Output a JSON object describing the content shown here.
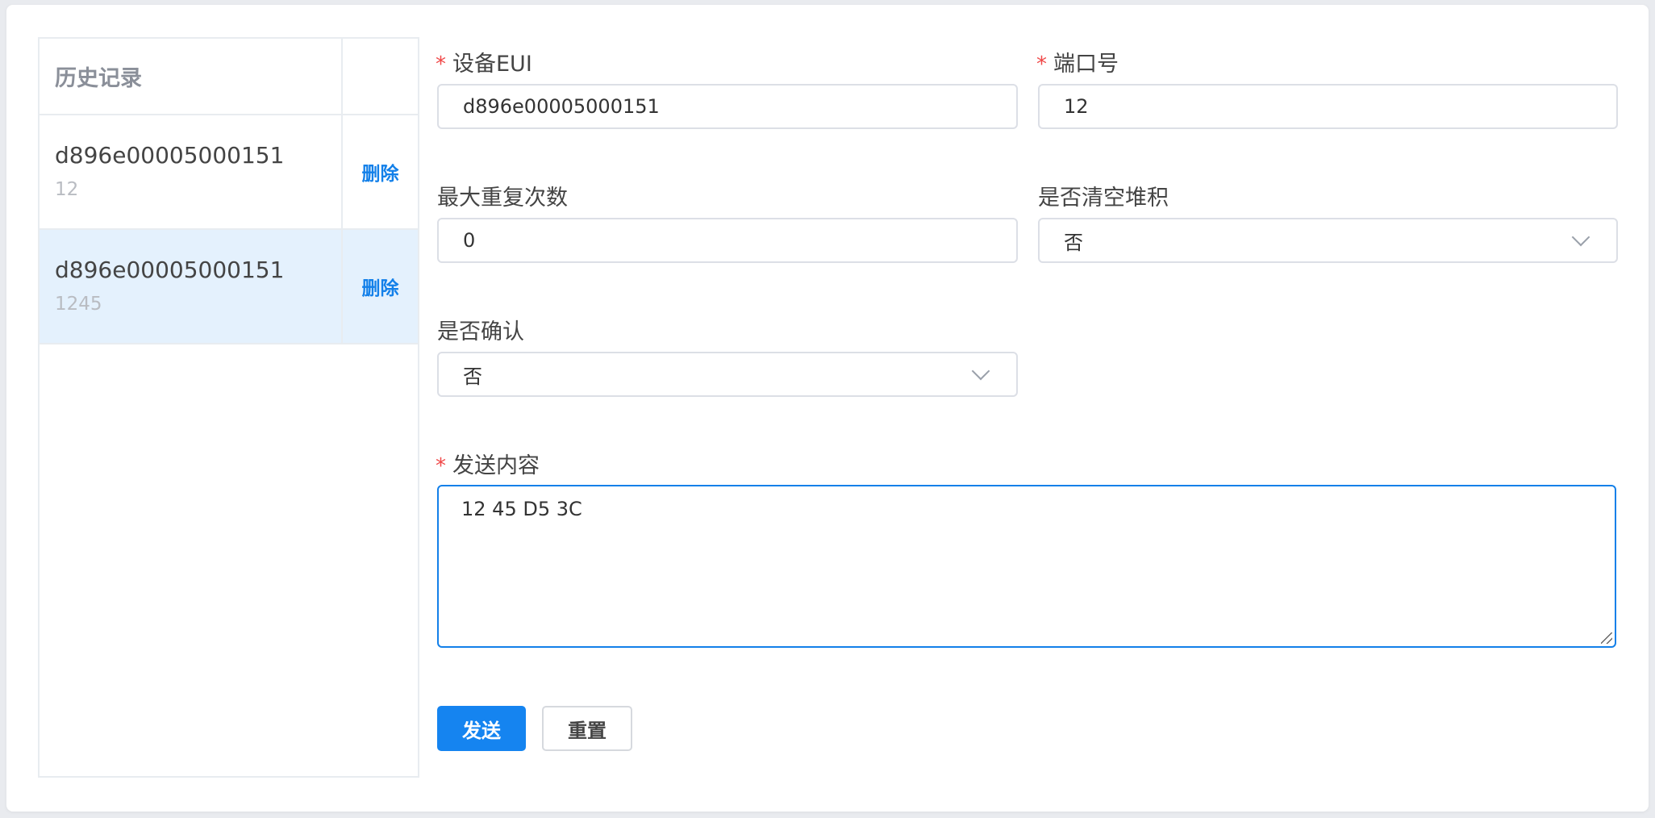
{
  "history": {
    "header": "历史记录",
    "rows": [
      {
        "eui": "d896e00005000151",
        "port": "12",
        "action": "删除",
        "selected": false
      },
      {
        "eui": "d896e00005000151",
        "port": "1245",
        "action": "删除",
        "selected": true
      }
    ]
  },
  "form": {
    "device_eui": {
      "label": "设备EUI",
      "required_mark": "*",
      "value": "d896e00005000151"
    },
    "port": {
      "label": "端口号",
      "required_mark": "*",
      "value": "12"
    },
    "max_retries": {
      "label": "最大重复次数",
      "value": "0"
    },
    "clear_queue": {
      "label": "是否清空堆积",
      "value": "否"
    },
    "confirm": {
      "label": "是否确认",
      "value": "否"
    },
    "payload": {
      "label": "发送内容",
      "required_mark": "*",
      "value": "12 45 D5 3C"
    }
  },
  "buttons": {
    "send": "发送",
    "reset": "重置"
  },
  "colors": {
    "primary": "#1584f0",
    "link": "#1380e9",
    "required": "#f04848",
    "selected_row": "#e4f1fd"
  }
}
